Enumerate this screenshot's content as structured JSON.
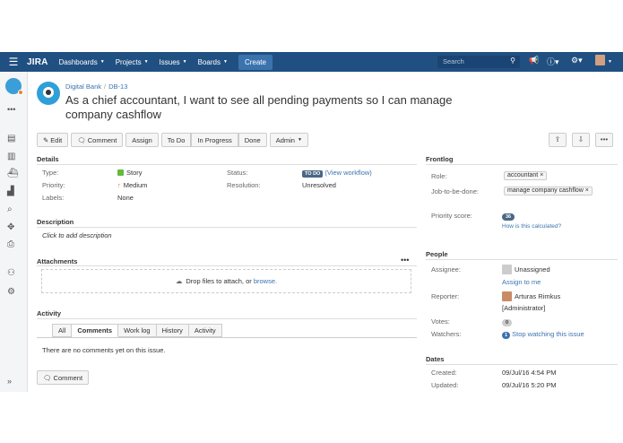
{
  "header": {
    "logo": "JIRA",
    "nav": [
      {
        "label": "Dashboards"
      },
      {
        "label": "Projects"
      },
      {
        "label": "Issues"
      },
      {
        "label": "Boards"
      }
    ],
    "create_label": "Create",
    "search_placeholder": "Search"
  },
  "breadcrumb": {
    "project": "Digital Bank",
    "issue_key": "DB-13"
  },
  "issue": {
    "title": "As a chief accountant, I want to see all pending payments so I can manage company cashflow"
  },
  "toolbar": {
    "edit": "Edit",
    "comment": "Comment",
    "assign": "Assign",
    "todo": "To Do",
    "in_progress": "In Progress",
    "done": "Done",
    "admin": "Admin"
  },
  "details": {
    "heading": "Details",
    "type_label": "Type:",
    "type_value": "Story",
    "priority_label": "Priority:",
    "priority_value": "Medium",
    "labels_label": "Labels:",
    "labels_value": "None",
    "status_label": "Status:",
    "status_value": "TO DO",
    "workflow_link": "(View workflow)",
    "resolution_label": "Resolution:",
    "resolution_value": "Unresolved"
  },
  "description": {
    "heading": "Description",
    "placeholder": "Click to add description"
  },
  "attachments": {
    "heading": "Attachments",
    "drop_text": "Drop files to attach, or",
    "browse": "browse."
  },
  "activity": {
    "heading": "Activity",
    "tabs": [
      "All",
      "Comments",
      "Work log",
      "History",
      "Activity"
    ],
    "active_tab": "Comments",
    "empty": "There are no comments yet on this issue.",
    "comment_button": "Comment"
  },
  "frontlog": {
    "heading": "Frontlog",
    "role_label": "Role:",
    "role_value": "accountant",
    "jtbd_label": "Job-to-be-done:",
    "jtbd_value": "manage company cashflow",
    "priority_score_label": "Priority score:",
    "priority_score_value": "36",
    "how_calculated": "How is this calculated?"
  },
  "people": {
    "heading": "People",
    "assignee_label": "Assignee:",
    "assignee_value": "Unassigned",
    "assign_to_me": "Assign to me",
    "reporter_label": "Reporter:",
    "reporter_name": "Arturas Rimkus",
    "reporter_role": "[Administrator]",
    "votes_label": "Votes:",
    "votes_value": "0",
    "watchers_label": "Watchers:",
    "watchers_count": "1",
    "stop_watching": "Stop watching this issue"
  },
  "dates": {
    "heading": "Dates",
    "created_label": "Created:",
    "created_value": "09/Jul/16 4:54 PM",
    "updated_label": "Updated:",
    "updated_value": "09/Jul/16 5:20 PM"
  },
  "colors": {
    "header": "#205081",
    "link": "#3b73af",
    "status": "#4a6785"
  }
}
